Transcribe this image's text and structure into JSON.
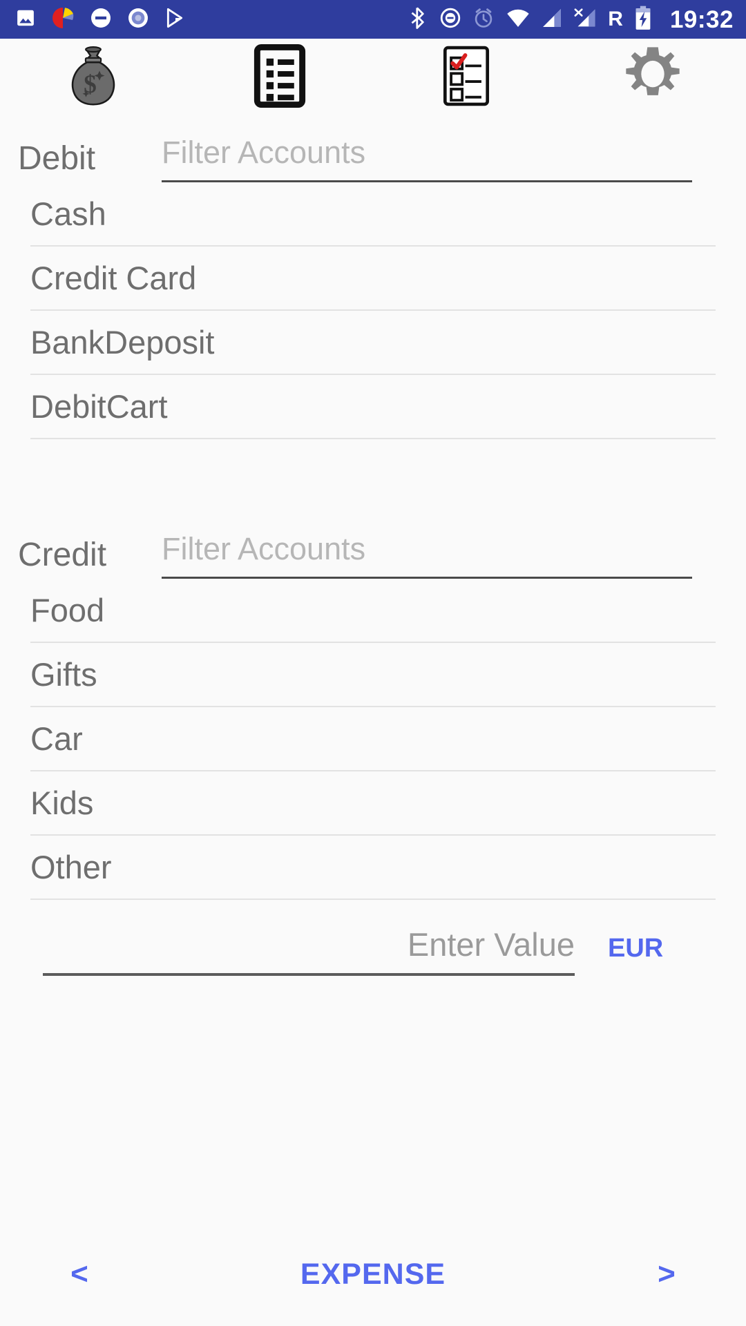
{
  "statusbar": {
    "time": "19:32",
    "roaming_label": "R",
    "left_icons": [
      {
        "name": "image-icon"
      },
      {
        "name": "pie-chart-app-icon"
      },
      {
        "name": "do-not-disturb-icon"
      },
      {
        "name": "record-circle-icon"
      },
      {
        "name": "play-store-icon"
      }
    ],
    "right_icons": [
      {
        "name": "bluetooth-icon"
      },
      {
        "name": "do-not-disturb-icon"
      },
      {
        "name": "alarm-clock-icon"
      },
      {
        "name": "wifi-icon"
      },
      {
        "name": "cellular-signal-icon"
      },
      {
        "name": "cellular-no-sim-icon"
      },
      {
        "name": "battery-charging-icon"
      }
    ]
  },
  "toolbar": {
    "items": [
      {
        "name": "money-bag-icon",
        "label": "Money Bag"
      },
      {
        "name": "list-document-icon",
        "label": "Transactions List"
      },
      {
        "name": "checklist-icon",
        "label": "Checklist"
      },
      {
        "name": "gear-icon",
        "label": "Settings"
      }
    ]
  },
  "debit": {
    "label": "Debit",
    "filter_placeholder": "Filter Accounts",
    "filter_value": "",
    "accounts": [
      {
        "label": "Cash"
      },
      {
        "label": "Credit Card"
      },
      {
        "label": "BankDeposit"
      },
      {
        "label": "DebitCart"
      }
    ]
  },
  "credit": {
    "label": "Credit",
    "filter_placeholder": "Filter Accounts",
    "filter_value": "",
    "accounts": [
      {
        "label": "Food"
      },
      {
        "label": "Gifts"
      },
      {
        "label": "Car"
      },
      {
        "label": "Kids"
      },
      {
        "label": "Other"
      }
    ]
  },
  "amount": {
    "placeholder": "Enter Value",
    "value": "",
    "currency": "EUR"
  },
  "bottomnav": {
    "prev": "<",
    "title": "EXPENSE",
    "next": ">"
  },
  "colors": {
    "statusbar_bg": "#2f3d9e",
    "page_bg": "#fafafa",
    "accent_blue": "#5468ee",
    "text_grey": "#6e6e6e",
    "placeholder_grey": "#b6b6b6",
    "divider": "#e2e2e2"
  }
}
